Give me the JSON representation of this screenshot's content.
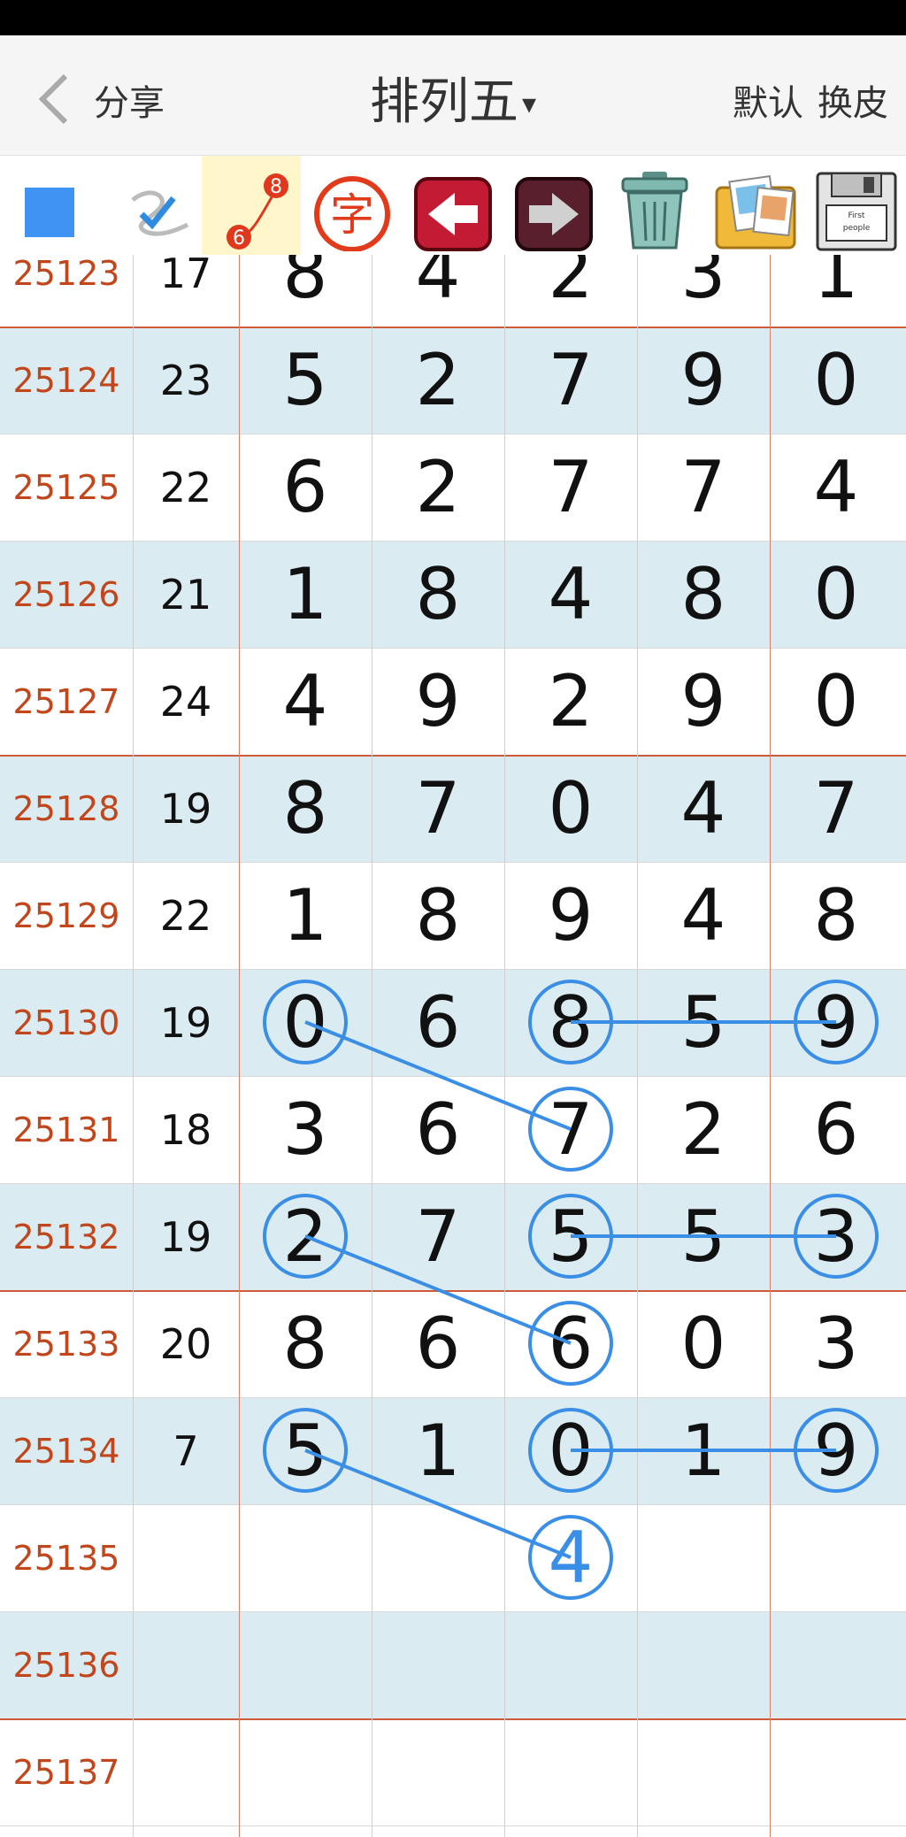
{
  "header": {
    "share_label": "分享",
    "title": "排列五",
    "title_caret": "▾",
    "default_label": "默认",
    "skin_label": "换皮"
  },
  "toolbar": {
    "icons": [
      "blue-square-icon",
      "pen-check-icon",
      "line-connect-icon",
      "char-icon",
      "arrow-left-icon",
      "arrow-right-icon",
      "trash-icon",
      "photos-icon",
      "floppy-disk-icon"
    ],
    "badge_top": "8",
    "badge_bottom": "6",
    "char_glyph": "字",
    "floppy_label_1": "First",
    "floppy_label_2": "people"
  },
  "rows": [
    {
      "issue": "25123",
      "sum": "17",
      "d": [
        "8",
        "4",
        "2",
        "3",
        "1"
      ]
    },
    {
      "issue": "25124",
      "sum": "23",
      "d": [
        "5",
        "2",
        "7",
        "9",
        "0"
      ]
    },
    {
      "issue": "25125",
      "sum": "22",
      "d": [
        "6",
        "2",
        "7",
        "7",
        "4"
      ]
    },
    {
      "issue": "25126",
      "sum": "21",
      "d": [
        "1",
        "8",
        "4",
        "8",
        "0"
      ]
    },
    {
      "issue": "25127",
      "sum": "24",
      "d": [
        "4",
        "9",
        "2",
        "9",
        "0"
      ]
    },
    {
      "issue": "25128",
      "sum": "19",
      "d": [
        "8",
        "7",
        "0",
        "4",
        "7"
      ]
    },
    {
      "issue": "25129",
      "sum": "22",
      "d": [
        "1",
        "8",
        "9",
        "4",
        "8"
      ]
    },
    {
      "issue": "25130",
      "sum": "19",
      "d": [
        "0",
        "6",
        "8",
        "5",
        "9"
      ]
    },
    {
      "issue": "25131",
      "sum": "18",
      "d": [
        "3",
        "6",
        "7",
        "2",
        "6"
      ]
    },
    {
      "issue": "25132",
      "sum": "19",
      "d": [
        "2",
        "7",
        "5",
        "5",
        "3"
      ]
    },
    {
      "issue": "25133",
      "sum": "20",
      "d": [
        "8",
        "6",
        "6",
        "0",
        "3"
      ]
    },
    {
      "issue": "25134",
      "sum": "7",
      "d": [
        "5",
        "1",
        "0",
        "1",
        "9"
      ]
    },
    {
      "issue": "25135",
      "sum": "",
      "d": [
        "",
        "",
        "4",
        "",
        ""
      ]
    },
    {
      "issue": "25136",
      "sum": "",
      "d": [
        "",
        "",
        "",
        "",
        ""
      ]
    },
    {
      "issue": "25137",
      "sum": "",
      "d": [
        "",
        "",
        "",
        "",
        ""
      ]
    }
  ],
  "circled": [
    [
      7,
      0
    ],
    [
      7,
      2
    ],
    [
      7,
      4
    ],
    [
      8,
      2
    ],
    [
      9,
      0
    ],
    [
      9,
      2
    ],
    [
      9,
      4
    ],
    [
      10,
      2
    ],
    [
      11,
      0
    ],
    [
      11,
      2
    ],
    [
      11,
      4
    ],
    [
      12,
      2
    ]
  ],
  "connections": [
    [
      [
        7,
        0
      ],
      [
        8,
        2
      ]
    ],
    [
      [
        7,
        2
      ],
      [
        7,
        4
      ]
    ],
    [
      [
        9,
        0
      ],
      [
        10,
        2
      ]
    ],
    [
      [
        9,
        2
      ],
      [
        9,
        4
      ]
    ],
    [
      [
        11,
        0
      ],
      [
        12,
        2
      ]
    ],
    [
      [
        11,
        2
      ],
      [
        11,
        4
      ]
    ]
  ],
  "colors": {
    "issue_text": "#c2461b",
    "highlight": "#3a8ee6",
    "alt_row": "#daecf2",
    "divider_red": "#cf5a3a"
  }
}
